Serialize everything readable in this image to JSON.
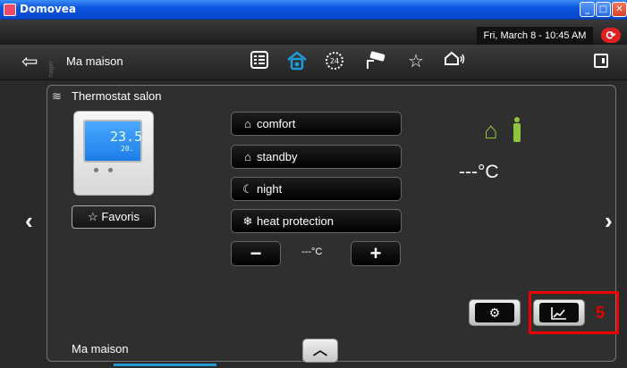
{
  "window": {
    "title": "Domovea"
  },
  "status": {
    "datetime": "Fri, March 8 - 10:45 AM",
    "sync_icon": "sync-icon"
  },
  "nav": {
    "brand": "hager",
    "title": "Ma maison",
    "icons": [
      "list-icon",
      "house-icon",
      "clock-24-icon",
      "camera-icon",
      "star-icon",
      "presence-icon"
    ],
    "active_icon": "house-icon"
  },
  "device": {
    "name": "Thermostat salon",
    "display_main": "23.5",
    "display_small": "20.",
    "favorite_label": "Favoris"
  },
  "modes": [
    {
      "label": "comfort",
      "icon": "comfort-icon"
    },
    {
      "label": "standby",
      "icon": "standby-icon"
    },
    {
      "label": "night",
      "icon": "night-icon"
    },
    {
      "label": "heat protection",
      "icon": "snowflake-icon"
    }
  ],
  "setpoint": {
    "value": "---°C"
  },
  "reading": {
    "temperature": "---°C"
  },
  "tools": {
    "settings_icon": "gears-icon",
    "chart_icon": "chart-icon"
  },
  "annotation": {
    "label": "5",
    "color": "#e00000"
  },
  "footer": {
    "location": "Ma maison"
  },
  "colors": {
    "accent": "#1e9bd7",
    "presence": "#8fc23d"
  }
}
